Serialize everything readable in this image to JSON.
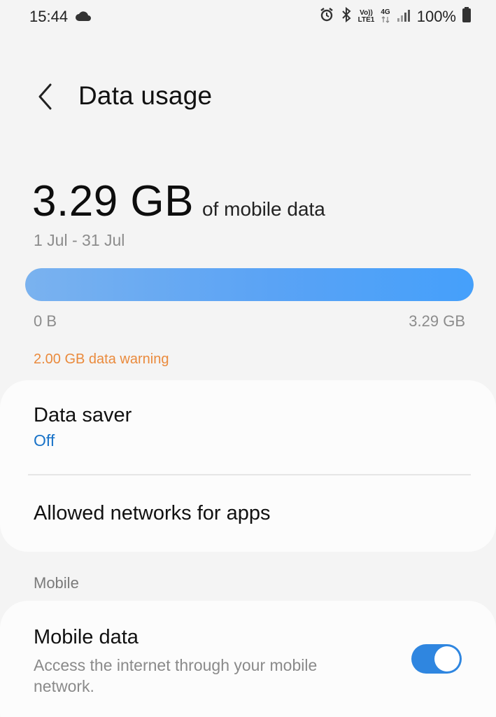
{
  "status_bar": {
    "time": "15:44",
    "network_top": "Vo))",
    "network_bottom": "LTE1",
    "network_type": "4G",
    "battery": "100%"
  },
  "header": {
    "title": "Data usage"
  },
  "usage": {
    "amount": "3.29 GB",
    "unit_text": "of mobile data",
    "period": "1 Jul - 31 Jul",
    "fill_fraction": 1.0,
    "scale_min": "0 B",
    "scale_max": "3.29 GB",
    "warning": "2.00 GB data warning"
  },
  "settings": {
    "data_saver": {
      "title": "Data saver",
      "value": "Off"
    },
    "allowed_networks": {
      "title": "Allowed networks for apps"
    },
    "section_mobile": "Mobile",
    "mobile_data": {
      "title": "Mobile data",
      "description": "Access the internet through your mobile network.",
      "enabled": true
    }
  },
  "colors": {
    "accent": "#2f86e0",
    "bar": "#5aa3f5",
    "warning": "#ea8a3c",
    "link": "#1a73c8"
  }
}
